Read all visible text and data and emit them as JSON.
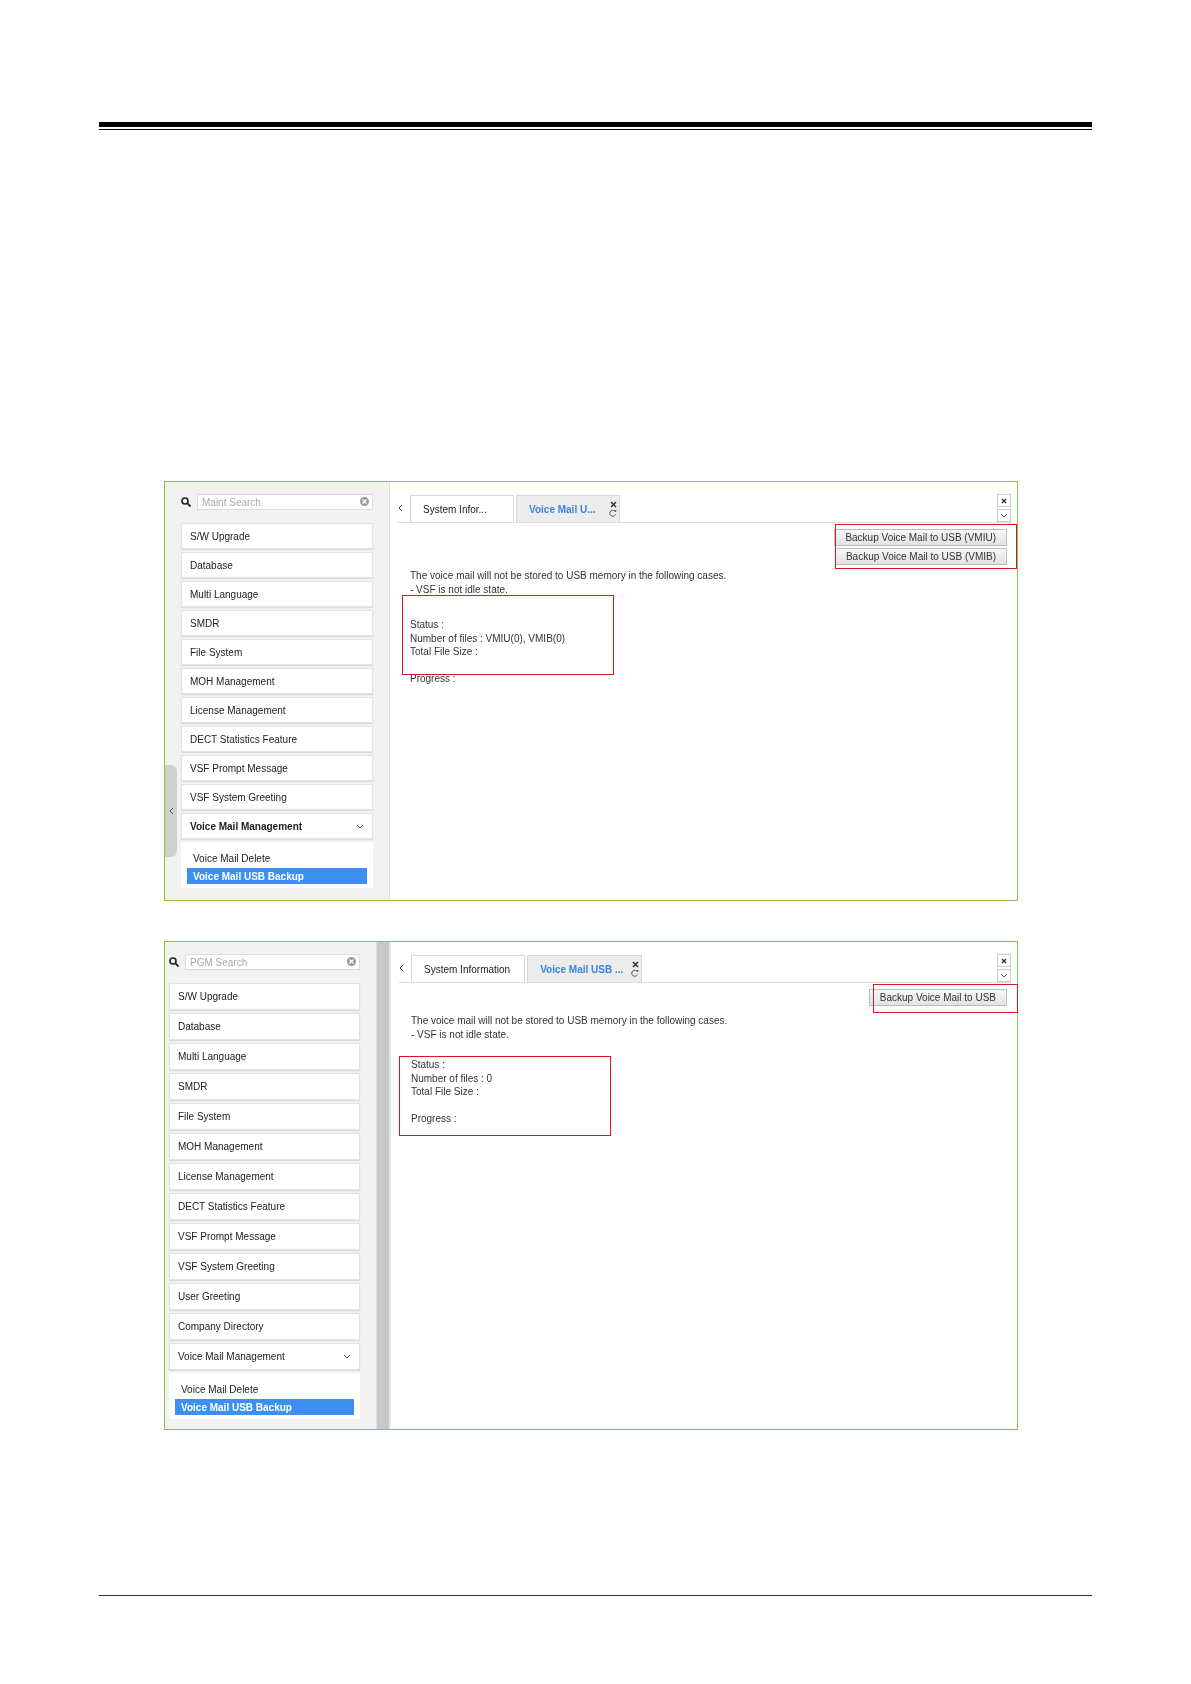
{
  "screenshots": [
    {
      "search": {
        "placeholder": "Maint Search"
      },
      "menu": [
        {
          "label": "S/W Upgrade"
        },
        {
          "label": "Database"
        },
        {
          "label": "Multi Language"
        },
        {
          "label": "SMDR"
        },
        {
          "label": "File System"
        },
        {
          "label": "MOH Management"
        },
        {
          "label": "License Management"
        },
        {
          "label": "DECT Statistics Feature"
        },
        {
          "label": "VSF Prompt Message"
        },
        {
          "label": "VSF System Greeting"
        }
      ],
      "group": {
        "label": "Voice Mail Management",
        "expanded": true,
        "active": true,
        "children": [
          {
            "label": "Voice Mail Delete",
            "selected": false
          },
          {
            "label": "Voice Mail USB Backup",
            "selected": true
          }
        ]
      },
      "tabs": [
        {
          "label": "System Infor...",
          "selected": false
        },
        {
          "label": "Voice Mail U...",
          "selected": true
        }
      ],
      "buttons": [
        "Backup Voice Mail to USB (VMIU)",
        "Backup Voice Mail to USB (VMIB)"
      ],
      "notice": [
        "The voice mail will not be stored to USB memory in the following cases.",
        "- VSF is not idle state."
      ],
      "status_lines": [
        "Status :",
        "Number of files : VMIU(0), VMIB(0)",
        "Total File Size :"
      ],
      "progress": "Progress :"
    },
    {
      "search": {
        "placeholder": "PGM Search"
      },
      "menu": [
        {
          "label": "S/W Upgrade"
        },
        {
          "label": "Database"
        },
        {
          "label": "Multi Language"
        },
        {
          "label": "SMDR"
        },
        {
          "label": "File System"
        },
        {
          "label": "MOH Management"
        },
        {
          "label": "License Management"
        },
        {
          "label": "DECT Statistics Feature"
        },
        {
          "label": "VSF Prompt Message"
        },
        {
          "label": "VSF System Greeting"
        },
        {
          "label": "User Greeting"
        },
        {
          "label": "Company Directory"
        }
      ],
      "group": {
        "label": "Voice Mail Management",
        "expanded": true,
        "active": false,
        "children": [
          {
            "label": "Voice Mail Delete",
            "selected": false
          },
          {
            "label": "Voice Mail USB Backup",
            "selected": true
          }
        ]
      },
      "tabs": [
        {
          "label": "System Information",
          "selected": false
        },
        {
          "label": "Voice Mail USB ...",
          "selected": true
        }
      ],
      "buttons": [
        "Backup Voice Mail to USB"
      ],
      "notice": [
        "The voice mail will not be stored to USB memory in the following cases.",
        "- VSF is not idle state."
      ],
      "status_lines": [
        "Status :",
        "Number of files : 0",
        "Total File Size :"
      ],
      "progress": "Progress :"
    }
  ]
}
